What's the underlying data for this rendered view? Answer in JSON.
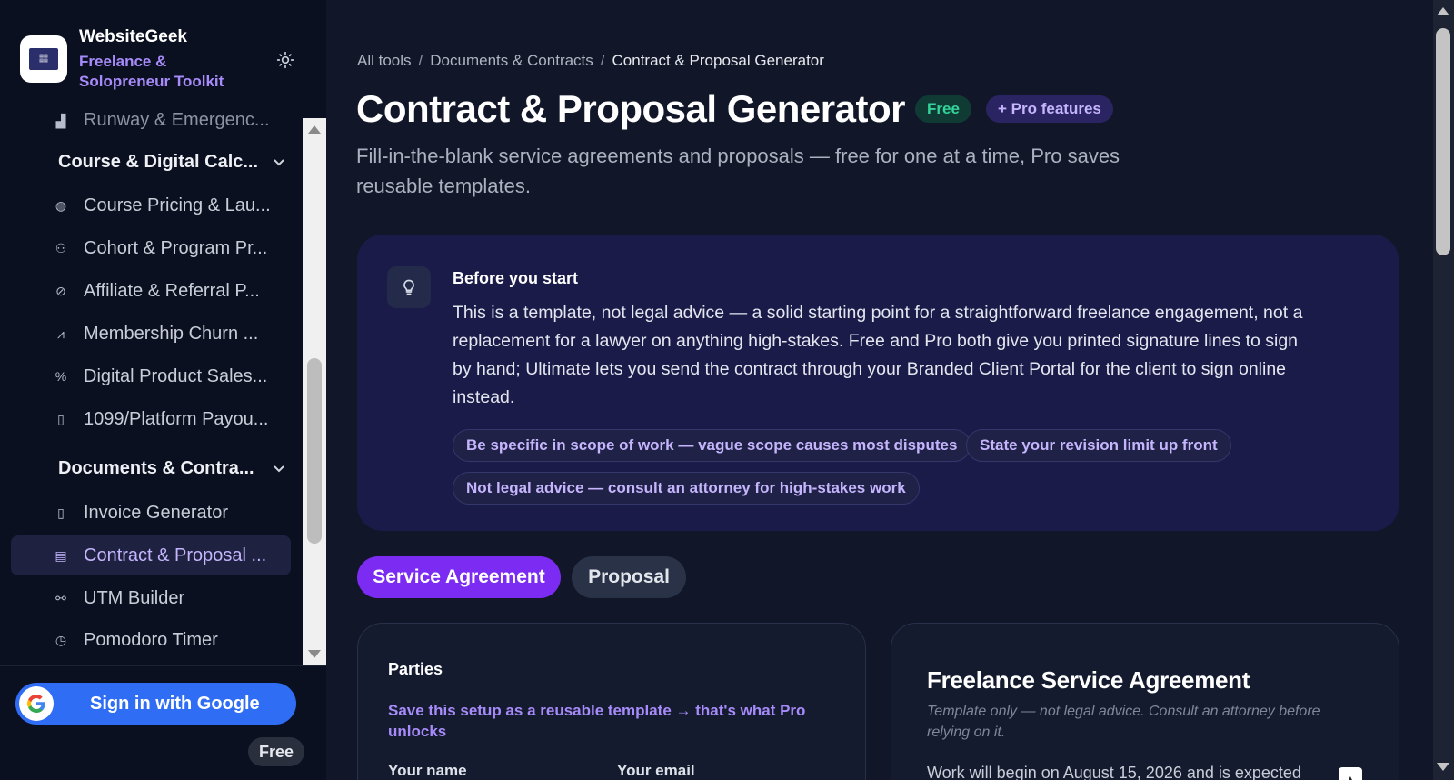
{
  "sidebar": {
    "brand_name": "WebsiteGeek",
    "brand_subtitle": "Freelance & Solopreneur Toolkit",
    "logo_icon": "toolkit-logo",
    "theme_toggle_icon": "sun-icon",
    "cutoff_item": "Runway & Emergenc...",
    "groups": [
      {
        "label": "Course & Digital Calc...",
        "items": [
          {
            "label": "Course Pricing & Lau...",
            "icon": "globe-icon"
          },
          {
            "label": "Cohort & Program Pr...",
            "icon": "users-icon"
          },
          {
            "label": "Affiliate & Referral P...",
            "icon": "link-icon"
          },
          {
            "label": "Membership Churn ...",
            "icon": "trend-icon"
          },
          {
            "label": "Digital Product Sales...",
            "icon": "percent-icon"
          },
          {
            "label": "1099/Platform Payou...",
            "icon": "receipt-icon"
          }
        ]
      },
      {
        "label": "Documents & Contra...",
        "items": [
          {
            "label": "Invoice Generator",
            "icon": "receipt-icon"
          },
          {
            "label": "Contract & Proposal ...",
            "icon": "document-icon",
            "active": true
          },
          {
            "label": "UTM Builder",
            "icon": "link-icon"
          },
          {
            "label": "Pomodoro Timer",
            "icon": "timer-icon"
          }
        ]
      }
    ],
    "footer": {
      "google_button": "Sign in with Google",
      "plan_badge": "Free"
    }
  },
  "main": {
    "breadcrumb": {
      "root": "All tools",
      "section": "Documents & Contracts",
      "current": "Contract & Proposal Generator",
      "separator": "/"
    },
    "title": "Contract & Proposal Generator",
    "badges": {
      "free": "Free",
      "pro": "+ Pro features"
    },
    "subtitle": "Fill-in-the-blank service agreements and proposals — free for one at a time, Pro saves reusable templates.",
    "info": {
      "icon": "lightbulb-icon",
      "heading": "Before you start",
      "body": "This is a template, not legal advice — a solid starting point for a straightforward freelance engagement, not a replacement for a lawyer on anything high-stakes. Free and Pro both give you printed signature lines to sign by hand; Ultimate lets you send the contract through your Branded Client Portal for the client to sign online instead.",
      "tips": [
        "Be specific in scope of work — vague scope causes most disputes",
        "State your revision limit up front",
        "Not legal advice — consult an attorney for high-stakes work"
      ]
    },
    "tabs": {
      "active": "Service Agreement",
      "inactive": "Proposal"
    },
    "form": {
      "heading": "Parties",
      "pro_link": "Save this setup as a reusable template → that's what Pro unlocks",
      "field_name": "Your name",
      "field_email": "Your email"
    },
    "preview": {
      "title": "Freelance Service Agreement",
      "note": "Template only — not legal advice. Consult an attorney before relying on it.",
      "text": "Work will begin on August 15, 2026 and is expected"
    }
  },
  "colors": {
    "accent": "#7c2cf2",
    "link": "#a78bfa",
    "free_badge": "#34d399",
    "background": "#111729",
    "sidebar": "#0b1020"
  }
}
